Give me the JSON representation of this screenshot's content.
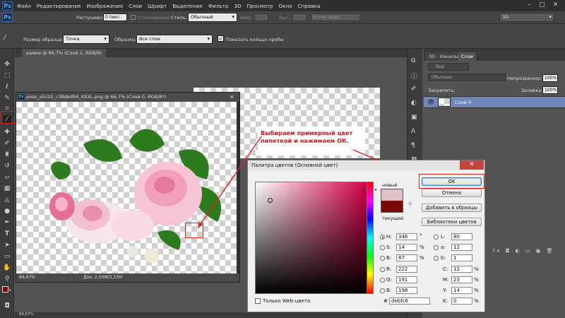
{
  "menubar": {
    "logo": "Ps",
    "items": [
      "Файл",
      "Редактирование",
      "Изображение",
      "Слои",
      "Шрифт",
      "Выделение",
      "Фильтр",
      "3D",
      "Просмотр",
      "Окно",
      "Справка"
    ],
    "min": "–",
    "max": "□",
    "close": "✕"
  },
  "options_bar_top": {
    "feather_label": "Растушевка:",
    "feather_value": "0 пикс.",
    "antialias_label": "Сглаживание",
    "style_label": "Стиль:",
    "style_value": "Обычный",
    "width_label": "Шир.:",
    "height_label": "Выс.:",
    "refine_edge": "Уточн. край...",
    "workspace": "3D"
  },
  "options_bar": {
    "sample_size_label": "Размер образца:",
    "sample_size_value": "Точка",
    "sample_label": "Образец:",
    "sample_value": "Все слои",
    "show_ring_label": "Показать кольцо пробы"
  },
  "tabs": {
    "frame_tab": "рамка @ 66,7% (Слой 1, RGB/8)"
  },
  "document": {
    "title": "poso_a5c02_c38ded94_XXXL.png @ 66,7% (Слой 0, RGB/8*)",
    "zoom": "66,67%",
    "doc_info": "Док: 2,50M/3,33M",
    "bottom_zoom": "66,67%"
  },
  "annotation": {
    "text": "Выбираем примерный цвет пипеткой и нажимаем ОК."
  },
  "layers_panel": {
    "tabs": [
      "3D",
      "Каналы",
      "Слои"
    ],
    "kind_label": "Вид",
    "blend_mode": "Обычные",
    "opacity_label": "Непрозрачность:",
    "opacity_value": "100%",
    "lock_label": "Закрепить:",
    "fill_label": "Заливка:",
    "fill_value": "100%",
    "layer_name": "Слой 0",
    "footer_icons": "fx ◘ ◐ ▭ ▣ 🗑"
  },
  "color_picker": {
    "title": "Палитра цветов (Основной цвет)",
    "new_label": "новый",
    "current_label": "текущий",
    "new_color": "#debfc6",
    "current_color": "#7a0a0a",
    "buttons": {
      "ok": "OK",
      "cancel": "Отмена",
      "add_swatch": "Добавить в образцы",
      "libraries": "Библиотеки цветов"
    },
    "fields": {
      "H": "346",
      "S": "14",
      "B": "87",
      "R": "222",
      "G": "191",
      "Bv": "198",
      "L": "80",
      "a": "12",
      "b": "1",
      "C": "12",
      "M": "23",
      "Y": "14",
      "K": "0",
      "hex": "debfc6"
    },
    "units": {
      "deg": "°",
      "pct": "%"
    },
    "labels": {
      "H": "H:",
      "S": "S:",
      "B": "B:",
      "R": "R:",
      "G": "G:",
      "Bv": "B:",
      "L": "L:",
      "a": "a:",
      "b": "b:",
      "C": "C:",
      "M": "M:",
      "Y": "Y:",
      "K": "K:",
      "hash": "#"
    },
    "web_only": "Только Web-цвета"
  }
}
